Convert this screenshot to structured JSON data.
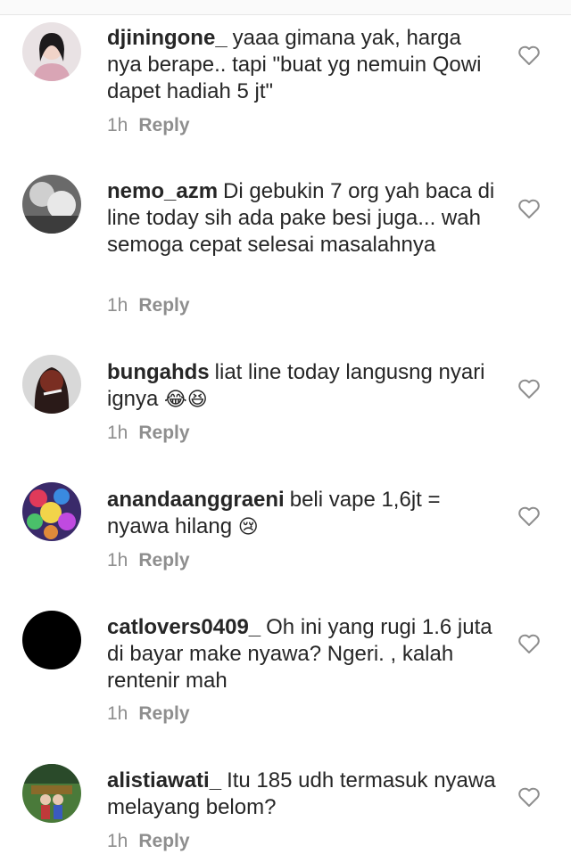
{
  "comments": [
    {
      "username": "djiningone_",
      "text": "yaaa gimana yak, harga nya berape.. tapi \"buat yg nemuin Qowi dapet hadiah 5 jt\"",
      "time": "1h",
      "reply_label": "Reply",
      "avatar_icon": "profile-photo"
    },
    {
      "username": "nemo_azm",
      "text": "Di gebukin 7 org yah baca di line today sih ada pake besi juga... wah semoga cepat selesai masalahnya",
      "time": "1h",
      "reply_label": "Reply",
      "avatar_icon": "profile-photo"
    },
    {
      "username": "bungahds",
      "text": "liat line today langusng nyari ignya",
      "emoji": "😂😆",
      "time": "1h",
      "reply_label": "Reply",
      "avatar_icon": "profile-photo"
    },
    {
      "username": "anandaanggraeni",
      "text": "beli vape 1,6jt = nyawa hilang",
      "emoji": "😢",
      "time": "1h",
      "reply_label": "Reply",
      "avatar_icon": "profile-photo"
    },
    {
      "username": "catlovers0409_",
      "text": "Oh ini yang rugi 1.6 juta di bayar make nyawa? Ngeri. , kalah rentenir mah",
      "time": "1h",
      "reply_label": "Reply",
      "avatar_icon": "profile-photo"
    },
    {
      "username": "alistiawati_",
      "text": "Itu 185 udh termasuk nyawa melayang belom?",
      "time": "1h",
      "reply_label": "Reply",
      "avatar_icon": "profile-photo"
    }
  ],
  "icons": {
    "like": "heart-outline-icon"
  },
  "colors": {
    "text": "#262626",
    "meta": "#8e8e8e",
    "heart": "#8e8e8e"
  }
}
